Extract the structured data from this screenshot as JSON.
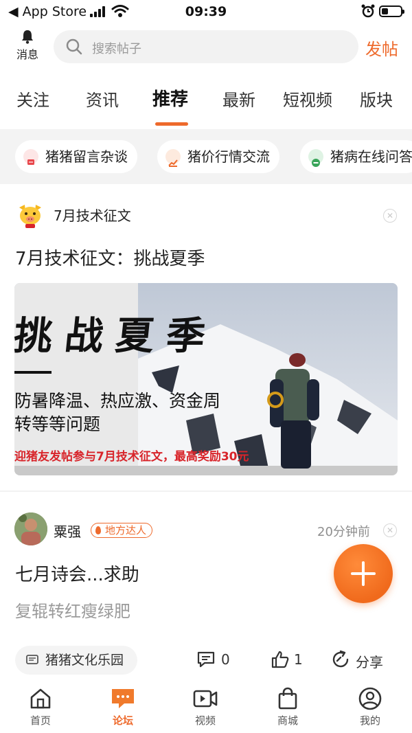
{
  "status_bar": {
    "back_label": "App Store",
    "time": "09:39"
  },
  "header": {
    "messages_label": "消息",
    "search_placeholder": "搜索帖子",
    "post_label": "发帖"
  },
  "tabs": [
    {
      "label": "关注"
    },
    {
      "label": "资讯"
    },
    {
      "label": "推荐",
      "active": true
    },
    {
      "label": "最新"
    },
    {
      "label": "短视频"
    },
    {
      "label": "版块"
    }
  ],
  "chips": [
    {
      "label": "猪猪留言杂谈",
      "icon": "chat-icon",
      "color": "#e8474c"
    },
    {
      "label": "猪价行情交流",
      "icon": "chart-icon",
      "color": "#ee6a2c"
    },
    {
      "label": "猪病在线问答",
      "icon": "medical-icon",
      "color": "#3aa55a"
    }
  ],
  "card1": {
    "tag": "7月技术征文",
    "title": "7月技术征文：挑战夏季",
    "banner": {
      "title": "挑战夏季",
      "subtitle_line1": "防暑降温、热应激、资金周",
      "subtitle_line2": "转等等问题",
      "promo": "迎猪友发帖参与7月技术征文，最高奖励30元"
    }
  },
  "post": {
    "username": "粟强",
    "badge": "地方达人",
    "time_ago": "20分钟前",
    "title": "七月诗会...求助",
    "body": "复辊转红瘦绿肥",
    "forum": "猪猪文化乐园",
    "comments": "0",
    "likes": "1",
    "share_label": "分享"
  },
  "bottom_nav": [
    {
      "label": "首页",
      "icon": "home-icon"
    },
    {
      "label": "论坛",
      "icon": "forum-icon",
      "active": true
    },
    {
      "label": "视频",
      "icon": "video-icon"
    },
    {
      "label": "商城",
      "icon": "shop-bag-icon"
    },
    {
      "label": "我的",
      "icon": "profile-icon"
    }
  ],
  "colors": {
    "accent": "#ee6a2c",
    "promo_red": "#d8242a"
  }
}
